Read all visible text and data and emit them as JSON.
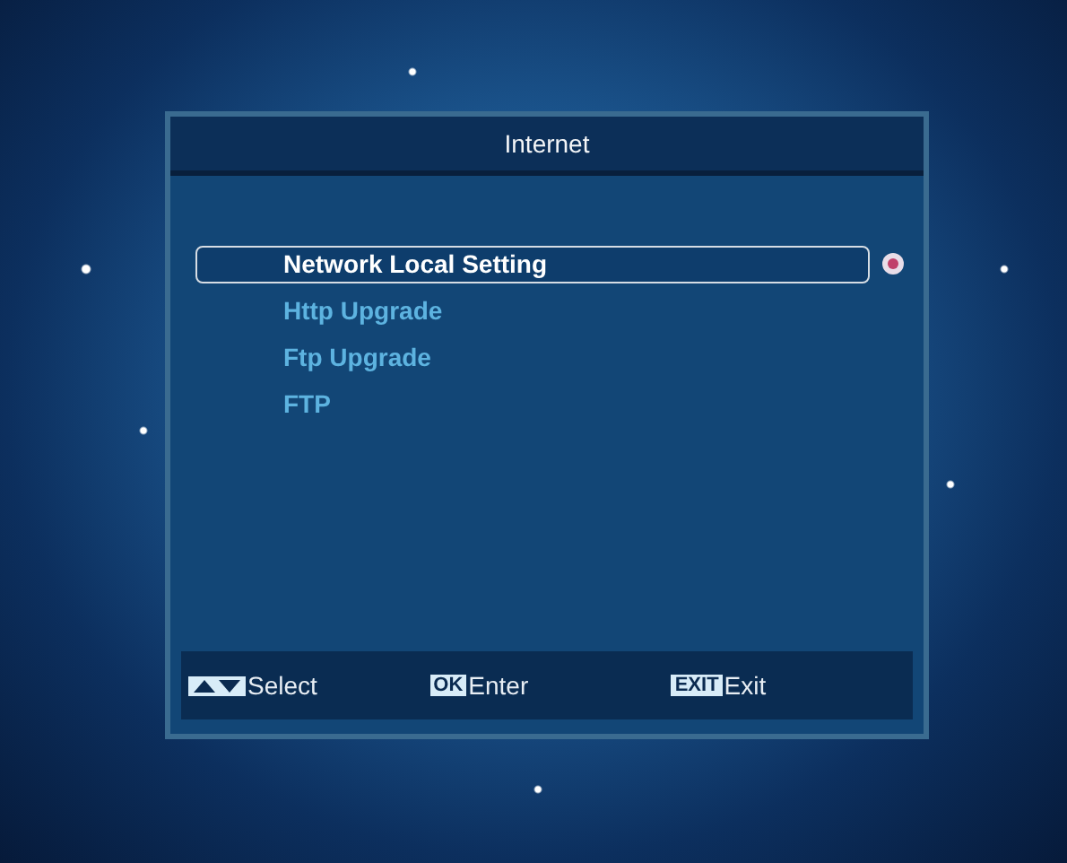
{
  "window": {
    "title": "Internet"
  },
  "menu": [
    {
      "label": "Network Local Setting",
      "selected": true
    },
    {
      "label": "Http Upgrade",
      "selected": false
    },
    {
      "label": "Ftp Upgrade",
      "selected": false
    },
    {
      "label": "FTP",
      "selected": false
    }
  ],
  "hints": [
    {
      "kind": "updown",
      "label": "Select"
    },
    {
      "kind": "key",
      "key": "OK",
      "label": "Enter"
    },
    {
      "kind": "key",
      "key": "EXIT",
      "label": "Exit"
    }
  ]
}
